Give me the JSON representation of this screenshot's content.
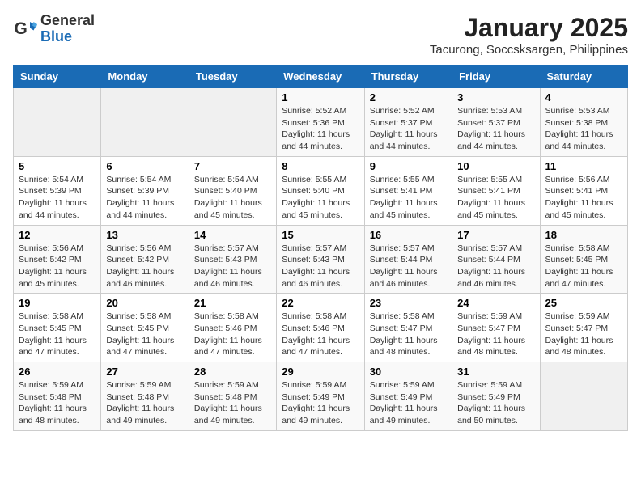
{
  "logo": {
    "general": "General",
    "blue": "Blue"
  },
  "title": "January 2025",
  "subtitle": "Tacurong, Soccsksargen, Philippines",
  "weekdays": [
    "Sunday",
    "Monday",
    "Tuesday",
    "Wednesday",
    "Thursday",
    "Friday",
    "Saturday"
  ],
  "weeks": [
    [
      {
        "day": "",
        "info": ""
      },
      {
        "day": "",
        "info": ""
      },
      {
        "day": "",
        "info": ""
      },
      {
        "day": "1",
        "info": "Sunrise: 5:52 AM\nSunset: 5:36 PM\nDaylight: 11 hours\nand 44 minutes."
      },
      {
        "day": "2",
        "info": "Sunrise: 5:52 AM\nSunset: 5:37 PM\nDaylight: 11 hours\nand 44 minutes."
      },
      {
        "day": "3",
        "info": "Sunrise: 5:53 AM\nSunset: 5:37 PM\nDaylight: 11 hours\nand 44 minutes."
      },
      {
        "day": "4",
        "info": "Sunrise: 5:53 AM\nSunset: 5:38 PM\nDaylight: 11 hours\nand 44 minutes."
      }
    ],
    [
      {
        "day": "5",
        "info": "Sunrise: 5:54 AM\nSunset: 5:39 PM\nDaylight: 11 hours\nand 44 minutes."
      },
      {
        "day": "6",
        "info": "Sunrise: 5:54 AM\nSunset: 5:39 PM\nDaylight: 11 hours\nand 44 minutes."
      },
      {
        "day": "7",
        "info": "Sunrise: 5:54 AM\nSunset: 5:40 PM\nDaylight: 11 hours\nand 45 minutes."
      },
      {
        "day": "8",
        "info": "Sunrise: 5:55 AM\nSunset: 5:40 PM\nDaylight: 11 hours\nand 45 minutes."
      },
      {
        "day": "9",
        "info": "Sunrise: 5:55 AM\nSunset: 5:41 PM\nDaylight: 11 hours\nand 45 minutes."
      },
      {
        "day": "10",
        "info": "Sunrise: 5:55 AM\nSunset: 5:41 PM\nDaylight: 11 hours\nand 45 minutes."
      },
      {
        "day": "11",
        "info": "Sunrise: 5:56 AM\nSunset: 5:41 PM\nDaylight: 11 hours\nand 45 minutes."
      }
    ],
    [
      {
        "day": "12",
        "info": "Sunrise: 5:56 AM\nSunset: 5:42 PM\nDaylight: 11 hours\nand 45 minutes."
      },
      {
        "day": "13",
        "info": "Sunrise: 5:56 AM\nSunset: 5:42 PM\nDaylight: 11 hours\nand 46 minutes."
      },
      {
        "day": "14",
        "info": "Sunrise: 5:57 AM\nSunset: 5:43 PM\nDaylight: 11 hours\nand 46 minutes."
      },
      {
        "day": "15",
        "info": "Sunrise: 5:57 AM\nSunset: 5:43 PM\nDaylight: 11 hours\nand 46 minutes."
      },
      {
        "day": "16",
        "info": "Sunrise: 5:57 AM\nSunset: 5:44 PM\nDaylight: 11 hours\nand 46 minutes."
      },
      {
        "day": "17",
        "info": "Sunrise: 5:57 AM\nSunset: 5:44 PM\nDaylight: 11 hours\nand 46 minutes."
      },
      {
        "day": "18",
        "info": "Sunrise: 5:58 AM\nSunset: 5:45 PM\nDaylight: 11 hours\nand 47 minutes."
      }
    ],
    [
      {
        "day": "19",
        "info": "Sunrise: 5:58 AM\nSunset: 5:45 PM\nDaylight: 11 hours\nand 47 minutes."
      },
      {
        "day": "20",
        "info": "Sunrise: 5:58 AM\nSunset: 5:45 PM\nDaylight: 11 hours\nand 47 minutes."
      },
      {
        "day": "21",
        "info": "Sunrise: 5:58 AM\nSunset: 5:46 PM\nDaylight: 11 hours\nand 47 minutes."
      },
      {
        "day": "22",
        "info": "Sunrise: 5:58 AM\nSunset: 5:46 PM\nDaylight: 11 hours\nand 47 minutes."
      },
      {
        "day": "23",
        "info": "Sunrise: 5:58 AM\nSunset: 5:47 PM\nDaylight: 11 hours\nand 48 minutes."
      },
      {
        "day": "24",
        "info": "Sunrise: 5:59 AM\nSunset: 5:47 PM\nDaylight: 11 hours\nand 48 minutes."
      },
      {
        "day": "25",
        "info": "Sunrise: 5:59 AM\nSunset: 5:47 PM\nDaylight: 11 hours\nand 48 minutes."
      }
    ],
    [
      {
        "day": "26",
        "info": "Sunrise: 5:59 AM\nSunset: 5:48 PM\nDaylight: 11 hours\nand 48 minutes."
      },
      {
        "day": "27",
        "info": "Sunrise: 5:59 AM\nSunset: 5:48 PM\nDaylight: 11 hours\nand 49 minutes."
      },
      {
        "day": "28",
        "info": "Sunrise: 5:59 AM\nSunset: 5:48 PM\nDaylight: 11 hours\nand 49 minutes."
      },
      {
        "day": "29",
        "info": "Sunrise: 5:59 AM\nSunset: 5:49 PM\nDaylight: 11 hours\nand 49 minutes."
      },
      {
        "day": "30",
        "info": "Sunrise: 5:59 AM\nSunset: 5:49 PM\nDaylight: 11 hours\nand 49 minutes."
      },
      {
        "day": "31",
        "info": "Sunrise: 5:59 AM\nSunset: 5:49 PM\nDaylight: 11 hours\nand 50 minutes."
      },
      {
        "day": "",
        "info": ""
      }
    ]
  ]
}
